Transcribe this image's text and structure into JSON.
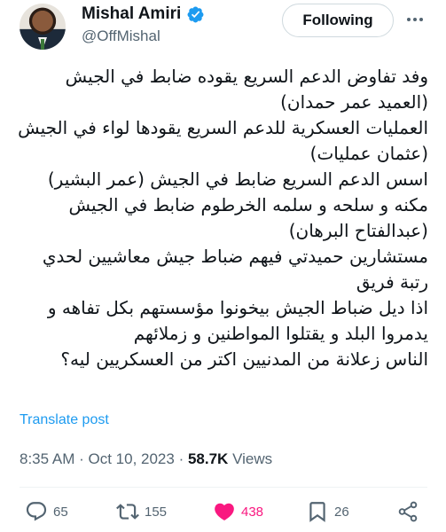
{
  "author": {
    "display_name": "Mishal Amiri",
    "handle": "@OffMishal",
    "verified": true,
    "follow_label": "Following"
  },
  "tweet": {
    "lines": [
      "وفد تفاوض الدعم السريع يقوده ضابط في الجيش",
      "(العميد عمر حمدان)",
      "العمليات العسكرية للدعم السريع يقودها لواء في الجيش",
      "(عثمان عمليات)",
      "اسس الدعم السريع ضابط في الجيش (عمر البشير)",
      "مكنه و سلحه و سلمه الخرطوم ضابط في الجيش",
      "(عبدالفتاح البرهان)",
      "مستشارين حميدتي فيهم ضباط جيش معاشيين لحدي",
      "رتبة فريق",
      "اذا ديل ضباط الجيش بيخونوا مؤسستهم بكل تفاهه و",
      "يدمروا البلد و يقتلوا المواطنين و زملائهم",
      "الناس زعلانة من المدنيين اكتر من العسكريين ليه؟"
    ],
    "translate_label": "Translate post",
    "time": "8:35 AM",
    "date": "Oct 10, 2023",
    "views_count": "58.7K",
    "views_label": "Views"
  },
  "actions": {
    "replies": "65",
    "reposts": "155",
    "likes": "438",
    "bookmarks": "26"
  },
  "colors": {
    "accent": "#1d9bf0",
    "like": "#f91880",
    "muted": "#536471",
    "text": "#0f1419"
  }
}
